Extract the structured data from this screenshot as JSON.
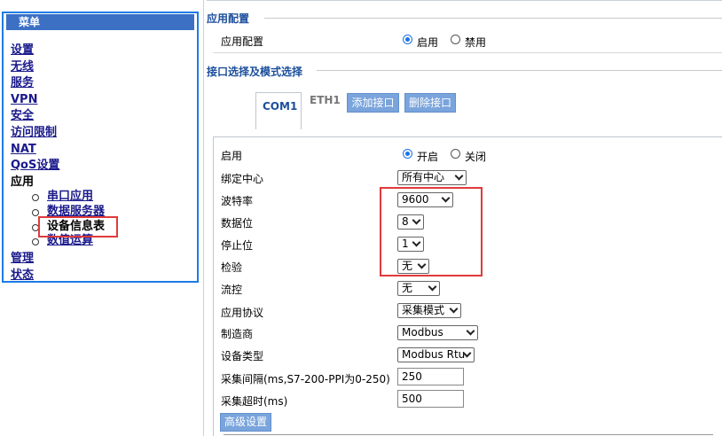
{
  "sidebar": {
    "header": "菜单",
    "items": [
      {
        "label": "设置",
        "link": true
      },
      {
        "label": "无线",
        "link": true
      },
      {
        "label": "服务",
        "link": true
      },
      {
        "label": "VPN",
        "link": true
      },
      {
        "label": "安全",
        "link": true
      },
      {
        "label": "访问限制",
        "link": true
      },
      {
        "label": "NAT",
        "link": true
      },
      {
        "label": "QoS设置",
        "link": true
      },
      {
        "label": "应用",
        "link": false
      }
    ],
    "sub_items": [
      {
        "label": "串口应用",
        "current": false
      },
      {
        "label": "数据服务器",
        "current": false
      },
      {
        "label": "设备信息表",
        "current": true
      },
      {
        "label": "数值运算",
        "current": false
      }
    ],
    "bottom_items": [
      {
        "label": "管理"
      },
      {
        "label": "状态"
      }
    ]
  },
  "app_config": {
    "section_title": "应用配置",
    "row_label": "应用配置",
    "options": [
      "启用",
      "禁用"
    ],
    "selected": "启用"
  },
  "interface": {
    "section_title": "接口选择及模式选择",
    "tabs": [
      "COM1",
      "ETH1"
    ],
    "active_tab": "COM1",
    "add_button": "添加接口",
    "delete_button": "删除接口"
  },
  "form": {
    "enable": {
      "label": "启用",
      "options": [
        "开启",
        "关闭"
      ],
      "selected": "开启"
    },
    "bind_center": {
      "label": "绑定中心",
      "value": "所有中心"
    },
    "baud_rate": {
      "label": "波特率",
      "value": "9600"
    },
    "data_bits": {
      "label": "数据位",
      "value": "8"
    },
    "stop_bits": {
      "label": "停止位",
      "value": "1"
    },
    "parity": {
      "label": "检验",
      "value": "无"
    },
    "flow_control": {
      "label": "流控",
      "value": "无"
    },
    "app_protocol": {
      "label": "应用协议",
      "value": "采集模式"
    },
    "manufacturer": {
      "label": "制造商",
      "value": "Modbus"
    },
    "device_type": {
      "label": "设备类型",
      "value": "Modbus Rtu"
    },
    "interval": {
      "label": "采集间隔(ms,S7-200-PPI为0-250)",
      "value": "250"
    },
    "timeout": {
      "label": "采集超时(ms)",
      "value": "500"
    },
    "advanced_button": "高级设置"
  },
  "colors": {
    "accent_blue": "#1e7be6",
    "section_title": "#1c4e9c",
    "highlight_red": "#e03a3a",
    "button_bg": "#7aa4dc"
  }
}
